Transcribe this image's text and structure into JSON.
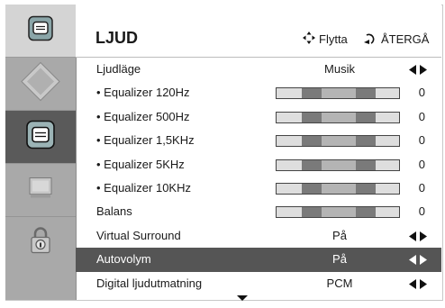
{
  "header": {
    "title": "LJUD",
    "move_hint": "Flytta",
    "back_hint": "ÅTERGÅ"
  },
  "sidebar": {
    "items": [
      {
        "icon": "picture-menu-icon",
        "selected": false
      },
      {
        "icon": "audio-menu-icon",
        "selected": true
      },
      {
        "icon": "setup-menu-icon",
        "selected": false
      },
      {
        "icon": "lock-menu-icon",
        "selected": false
      }
    ]
  },
  "rows": [
    {
      "label": "Ljudläge",
      "type": "option",
      "value": "Musik"
    },
    {
      "label": "• Equalizer 120Hz",
      "type": "bar",
      "value": "0",
      "level": 0.5
    },
    {
      "label": "• Equalizer 500Hz",
      "type": "bar",
      "value": "0",
      "level": 0.5
    },
    {
      "label": "• Equalizer 1,5KHz",
      "type": "bar",
      "value": "0",
      "level": 0.5
    },
    {
      "label": "• Equalizer 5KHz",
      "type": "bar",
      "value": "0",
      "level": 0.5
    },
    {
      "label": "• Equalizer 10KHz",
      "type": "bar",
      "value": "0",
      "level": 0.5
    },
    {
      "label": "Balans",
      "type": "bar",
      "value": "0",
      "level": 0.5
    },
    {
      "label": "Virtual Surround",
      "type": "option",
      "value": "På"
    },
    {
      "label": "Autovolym",
      "type": "option",
      "value": "På",
      "selected": true
    },
    {
      "label": "Digital ljudutmatning",
      "type": "option",
      "value": "PCM"
    }
  ],
  "colors": {
    "selected_row": "#555555",
    "sidebar": "#a9a9a9",
    "sidebar_selected": "#5a5a5a"
  }
}
